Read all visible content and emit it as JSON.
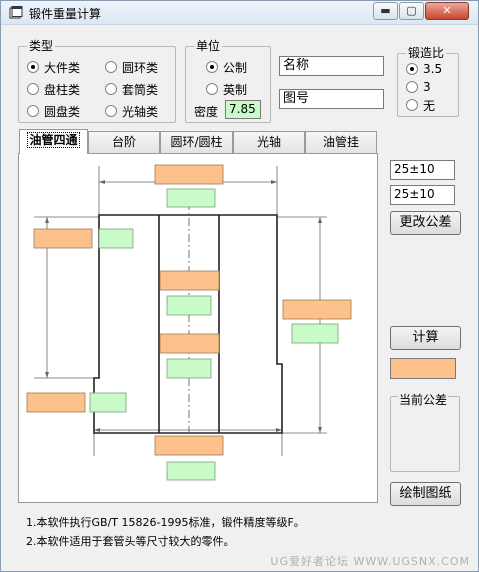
{
  "window": {
    "title": "锻件重量计算",
    "minimize_glyph": "▬",
    "maximize_glyph": "▢",
    "close_glyph": "✕"
  },
  "type_group": {
    "title": "类型",
    "options": [
      "大件类",
      "盘柱类",
      "圆盘类",
      "圆环类",
      "套筒类",
      "光轴类"
    ],
    "selected": "大件类"
  },
  "unit_group": {
    "title": "单位",
    "options": [
      "公制",
      "英制"
    ],
    "selected": "公制",
    "density_label": "密度",
    "density_value": "7.85"
  },
  "fields": {
    "name_value": "名称",
    "drawing_no_value": "图号"
  },
  "forging_ratio": {
    "title": "锻造比",
    "options": [
      "3.5",
      "3",
      "无"
    ],
    "selected": "3.5"
  },
  "tabs": [
    "油管四通",
    "台阶",
    "圆环/圆柱",
    "光轴",
    "油管挂"
  ],
  "active_tab": "油管四通",
  "tolerances": {
    "tolerance_1": "25±10",
    "tolerance_2": "25±10"
  },
  "buttons": {
    "change_tolerance": "更改公差",
    "calculate": "计算",
    "draw": "绘制图纸"
  },
  "current_tolerance": {
    "title": "当前公差"
  },
  "notes": [
    "1.本软件执行GB/T 15826-1995标准，锻件精度等级F。",
    "2.本软件适用于套管头等尺寸较大的零件。"
  ],
  "watermark": "UG爱好者论坛 WWW.UGSNX.COM",
  "colors": {
    "dimension_input": "#fdc28c",
    "result_field": "#c8fbc8",
    "density_field": "#c8fbc8"
  }
}
